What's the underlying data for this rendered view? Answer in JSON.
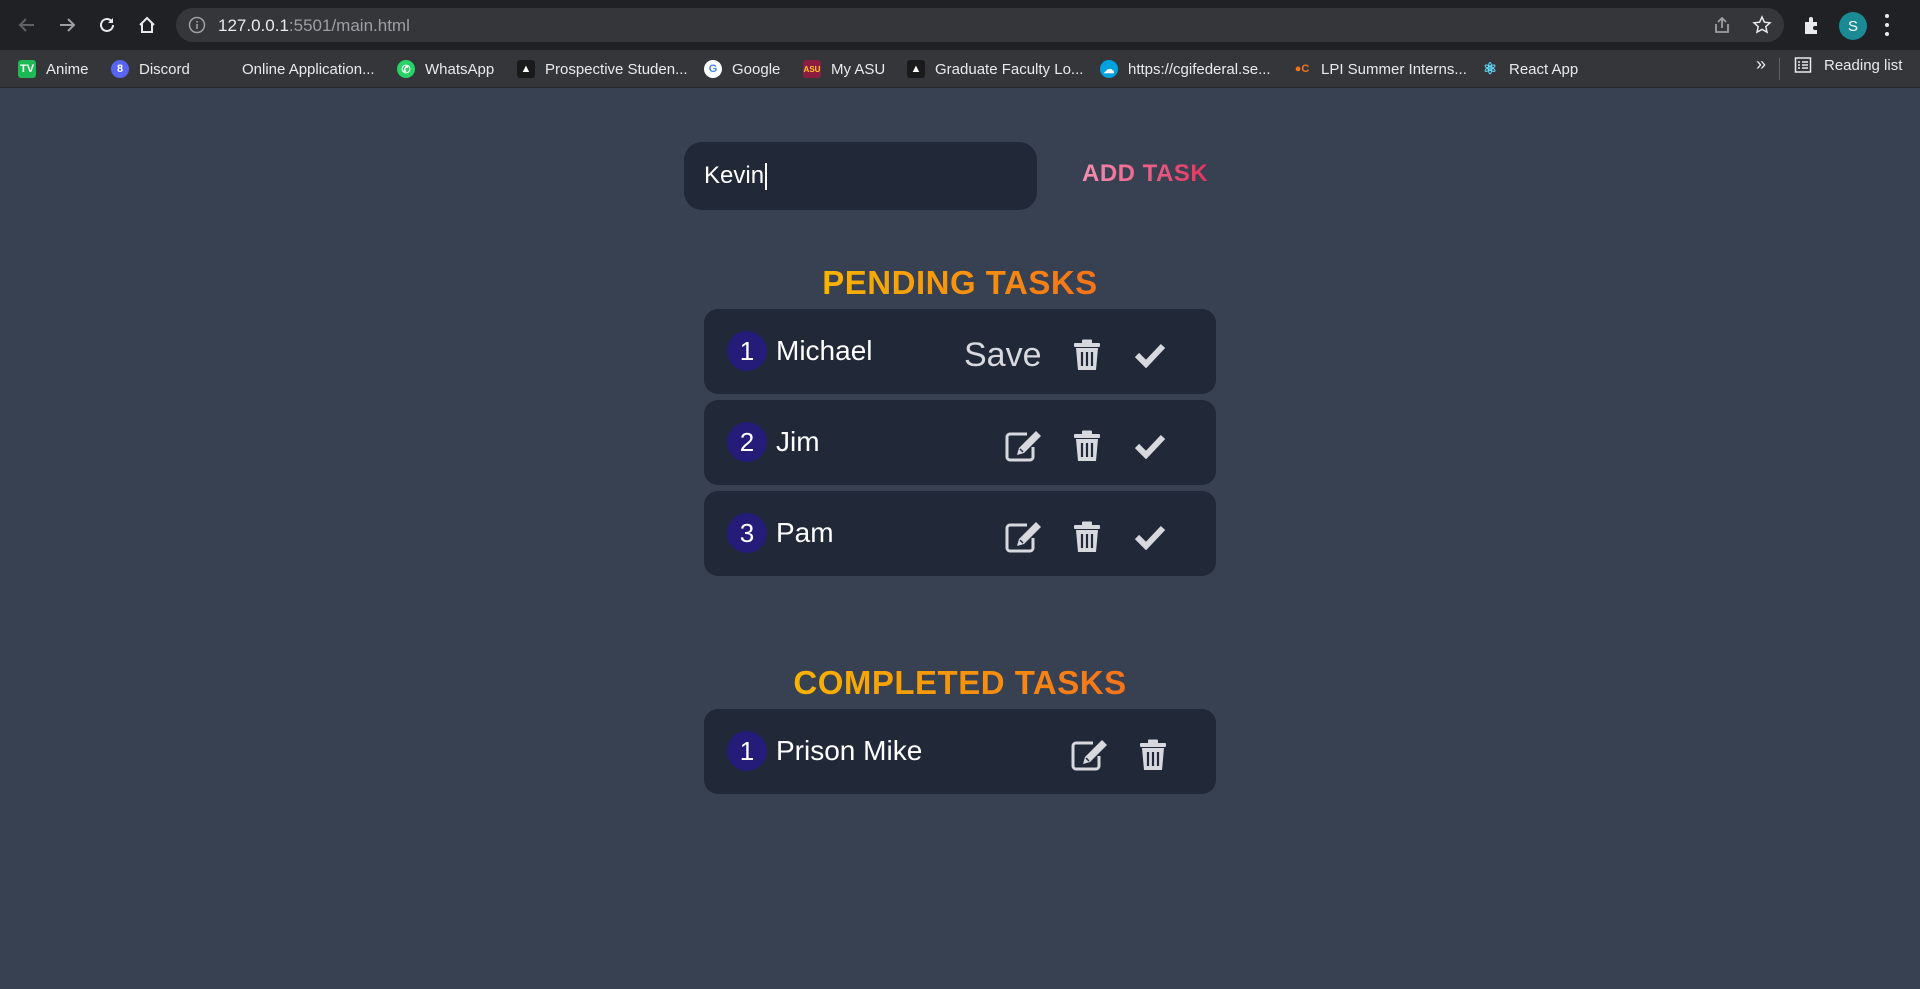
{
  "browser": {
    "url_host": "127.0.0.1",
    "url_path": ":5501/main.html",
    "profile_initial": "S",
    "bookmarks": [
      {
        "label": "Anime",
        "icon": "tv-icon",
        "color": "#1db954"
      },
      {
        "label": "Discord",
        "icon": "discord-icon",
        "color": "#5865f2"
      },
      {
        "label": "Online Application...",
        "icon": "blank-icon",
        "color": "#35363a"
      },
      {
        "label": "WhatsApp",
        "icon": "whatsapp-icon",
        "color": "#25d366"
      },
      {
        "label": "Prospective Studen...",
        "icon": "asu-icon",
        "color": "#1a1a1a"
      },
      {
        "label": "Google",
        "icon": "google-icon",
        "color": "#ffffff"
      },
      {
        "label": "My ASU",
        "icon": "myasu-icon",
        "color": "#8c1d40"
      },
      {
        "label": "Graduate Faculty Lo...",
        "icon": "asu-icon",
        "color": "#1a1a1a"
      },
      {
        "label": "https://cgifederal.se...",
        "icon": "salesforce-icon",
        "color": "#00a1e0"
      },
      {
        "label": "LPI Summer Interns...",
        "icon": "lpi-icon",
        "color": "#f5731a"
      },
      {
        "label": "React App",
        "icon": "react-icon",
        "color": "#61dafb"
      }
    ],
    "more": "»",
    "reading_list": "Reading list"
  },
  "app": {
    "input_value": "Kevin",
    "add_label": "ADD TASK",
    "pending_title": "PENDING TASKS",
    "completed_title": "COMPLETED TASKS",
    "pending": [
      {
        "num": "1",
        "name": "Michael",
        "editing": true,
        "save_label": "Save"
      },
      {
        "num": "2",
        "name": "Jim",
        "editing": false
      },
      {
        "num": "3",
        "name": "Pam",
        "editing": false
      }
    ],
    "completed": [
      {
        "num": "1",
        "name": "Prison Mike"
      }
    ]
  },
  "colors": {
    "background": "#384152",
    "card": "#212837",
    "badge": "#241c78",
    "title_gradient": [
      "#f8b400",
      "#f5731a"
    ],
    "add_gradient": [
      "#f78fb3",
      "#e0365e"
    ],
    "icon": "#d7d9de"
  }
}
